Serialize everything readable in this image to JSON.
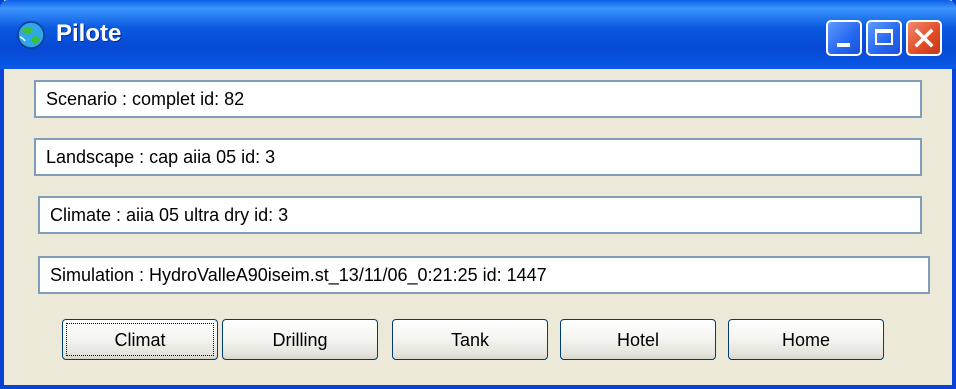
{
  "window": {
    "title": "Pilote",
    "icon": "globe-icon"
  },
  "titlebar_buttons": {
    "minimize": "minimize-icon",
    "maximize": "maximize-icon",
    "close": "close-icon"
  },
  "info": {
    "scenario": "Scenario : complet   id: 82",
    "landscape": "Landscape : cap aiia 05   id: 3",
    "climate": "Climate : aiia 05 ultra dry   id: 3",
    "simulation": "Simulation : HydroValleA90iseim.st_13/11/06_0:21:25   id: 1447"
  },
  "buttons": {
    "climat": "Climat",
    "drilling": "Drilling",
    "tank": "Tank",
    "hotel": "Hotel",
    "home": "Home"
  },
  "colors": {
    "titlebar": "#0a5ae0",
    "close": "#e04a24",
    "face": "#ece9d8",
    "field_border": "#7f9db9"
  }
}
